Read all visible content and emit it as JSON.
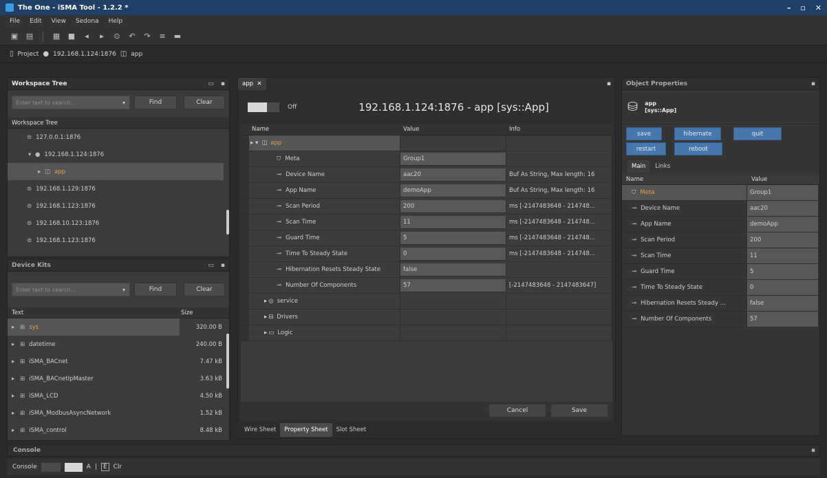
{
  "window": {
    "title": "The One - iSMA Tool - 1.2.2 *",
    "controls": [
      "–",
      "▫",
      "✕"
    ]
  },
  "menu": [
    "File",
    "Edit",
    "View",
    "Sedona",
    "Help"
  ],
  "breadcrumb": {
    "project": "Project",
    "host": "192.168.1.124:1876",
    "app": "app"
  },
  "workspace_tree": {
    "panel_title": "Workspace Tree",
    "search_placeholder": "Enter text to search...",
    "find_label": "Find",
    "clear_label": "Clear",
    "column_header": "Workspace Tree",
    "items": [
      {
        "label": "127.0.0.1:1876",
        "indent": 0,
        "selected": false
      },
      {
        "label": "192.168.1.124:1876",
        "indent": 0,
        "selected": false,
        "expanded": true
      },
      {
        "label": "app",
        "indent": 1,
        "selected": true
      },
      {
        "label": "192.168.1.129:1876",
        "indent": 0,
        "selected": false
      },
      {
        "label": "192.168.1.123:1876",
        "indent": 0,
        "selected": false
      },
      {
        "label": "192.168.10.123:1876",
        "indent": 0,
        "selected": false
      },
      {
        "label": "192.168.1.123:1876",
        "indent": 0,
        "selected": false
      }
    ]
  },
  "device_kits": {
    "panel_title": "Device Kits",
    "search_placeholder": "Enter text to search...",
    "find_label": "Find",
    "clear_label": "Clear",
    "columns": [
      "Text",
      "Size"
    ],
    "items": [
      {
        "name": "sys",
        "size": "320.00 B",
        "selected": true
      },
      {
        "name": "datetime",
        "size": "240.00 B"
      },
      {
        "name": "iSMA_BACnet",
        "size": "7.47 kB"
      },
      {
        "name": "iSMA_BACnetIpMaster",
        "size": "3.63 kB"
      },
      {
        "name": "iSMA_LCD",
        "size": "4.50 kB"
      },
      {
        "name": "iSMA_ModbusAsyncNetwork",
        "size": "1.52 kB"
      },
      {
        "name": "iSMA_control",
        "size": "8.48 kB"
      }
    ]
  },
  "editor": {
    "tab_label": "app",
    "toggle_label": "Off",
    "heading": "192.168.1.124:1876 - app [sys::App]",
    "columns": [
      "Name",
      "Value",
      "Info"
    ],
    "rows": [
      {
        "name": "app",
        "value": "",
        "info": "",
        "level": 0,
        "type": "root"
      },
      {
        "name": "Meta",
        "value": "Group1",
        "info": "",
        "level": 1,
        "type": "meta"
      },
      {
        "name": "Device Name",
        "value": "aac20",
        "info": "Buf As String, Max length: 16",
        "level": 1,
        "type": "prop"
      },
      {
        "name": "App Name",
        "value": "demoApp",
        "info": "Buf As String, Max length: 16",
        "level": 1,
        "type": "prop"
      },
      {
        "name": "Scan Period",
        "value": "200",
        "info": "ms [-2147483648 - 214748...",
        "level": 1,
        "type": "prop"
      },
      {
        "name": "Scan Time",
        "value": "11",
        "info": "ms [-2147483648 - 214748...",
        "level": 1,
        "type": "prop"
      },
      {
        "name": "Guard Time",
        "value": "5",
        "info": "ms [-2147483648 - 214748...",
        "level": 1,
        "type": "prop"
      },
      {
        "name": "Time To Steady State",
        "value": "0",
        "info": "ms [-2147483648 - 214748...",
        "level": 1,
        "type": "prop"
      },
      {
        "name": "Hibernation Resets Steady State",
        "value": "false",
        "info": "",
        "level": 1,
        "type": "prop"
      },
      {
        "name": "Number Of Components",
        "value": "57",
        "info": "[-2147483648 - 2147483647]",
        "level": 1,
        "type": "prop"
      },
      {
        "name": "service",
        "value": "",
        "info": "",
        "level": 1,
        "type": "folder"
      },
      {
        "name": "Drivers",
        "value": "",
        "info": "",
        "level": 1,
        "type": "folder"
      },
      {
        "name": "Logic",
        "value": "",
        "info": "",
        "level": 1,
        "type": "folder"
      }
    ],
    "cancel_label": "Cancel",
    "save_label": "Save",
    "bottom_tabs": [
      "Wire Sheet",
      "Property Sheet",
      "Slot Sheet"
    ]
  },
  "object_properties": {
    "panel_title": "Object Properties",
    "object_name": "app",
    "object_type": "[sys::App]",
    "actions": [
      "save",
      "hibernate",
      "quit",
      "restart",
      "reboot"
    ],
    "tabs": [
      "Main",
      "Links"
    ],
    "columns": [
      "Name",
      "Value"
    ],
    "rows": [
      {
        "name": "Meta",
        "value": "Group1",
        "type": "meta"
      },
      {
        "name": "Device Name",
        "value": "aac20"
      },
      {
        "name": "App Name",
        "value": "demoApp"
      },
      {
        "name": "Scan Period",
        "value": "200"
      },
      {
        "name": "Scan Time",
        "value": "11"
      },
      {
        "name": "Guard Time",
        "value": "5"
      },
      {
        "name": "Time To Steady State",
        "value": "0"
      },
      {
        "name": "Hibernation Resets Steady ...",
        "value": "false"
      },
      {
        "name": "Number Of Components",
        "value": "57"
      }
    ]
  },
  "console": {
    "panel_title": "Console",
    "label": "Console",
    "a_label": "A",
    "e_label": "E",
    "clr_label": "Clr"
  }
}
